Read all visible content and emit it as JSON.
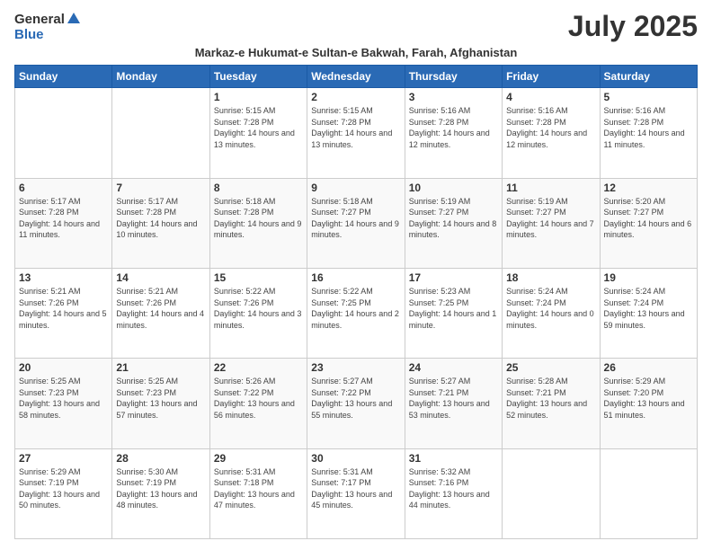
{
  "logo": {
    "general": "General",
    "blue": "Blue"
  },
  "title": "July 2025",
  "subtitle": "Markaz-e Hukumat-e Sultan-e Bakwah, Farah, Afghanistan",
  "days_header": [
    "Sunday",
    "Monday",
    "Tuesday",
    "Wednesday",
    "Thursday",
    "Friday",
    "Saturday"
  ],
  "weeks": [
    {
      "days": [
        {
          "num": "",
          "info": ""
        },
        {
          "num": "",
          "info": ""
        },
        {
          "num": "1",
          "info": "Sunrise: 5:15 AM\nSunset: 7:28 PM\nDaylight: 14 hours and 13 minutes."
        },
        {
          "num": "2",
          "info": "Sunrise: 5:15 AM\nSunset: 7:28 PM\nDaylight: 14 hours and 13 minutes."
        },
        {
          "num": "3",
          "info": "Sunrise: 5:16 AM\nSunset: 7:28 PM\nDaylight: 14 hours and 12 minutes."
        },
        {
          "num": "4",
          "info": "Sunrise: 5:16 AM\nSunset: 7:28 PM\nDaylight: 14 hours and 12 minutes."
        },
        {
          "num": "5",
          "info": "Sunrise: 5:16 AM\nSunset: 7:28 PM\nDaylight: 14 hours and 11 minutes."
        }
      ]
    },
    {
      "days": [
        {
          "num": "6",
          "info": "Sunrise: 5:17 AM\nSunset: 7:28 PM\nDaylight: 14 hours and 11 minutes."
        },
        {
          "num": "7",
          "info": "Sunrise: 5:17 AM\nSunset: 7:28 PM\nDaylight: 14 hours and 10 minutes."
        },
        {
          "num": "8",
          "info": "Sunrise: 5:18 AM\nSunset: 7:28 PM\nDaylight: 14 hours and 9 minutes."
        },
        {
          "num": "9",
          "info": "Sunrise: 5:18 AM\nSunset: 7:27 PM\nDaylight: 14 hours and 9 minutes."
        },
        {
          "num": "10",
          "info": "Sunrise: 5:19 AM\nSunset: 7:27 PM\nDaylight: 14 hours and 8 minutes."
        },
        {
          "num": "11",
          "info": "Sunrise: 5:19 AM\nSunset: 7:27 PM\nDaylight: 14 hours and 7 minutes."
        },
        {
          "num": "12",
          "info": "Sunrise: 5:20 AM\nSunset: 7:27 PM\nDaylight: 14 hours and 6 minutes."
        }
      ]
    },
    {
      "days": [
        {
          "num": "13",
          "info": "Sunrise: 5:21 AM\nSunset: 7:26 PM\nDaylight: 14 hours and 5 minutes."
        },
        {
          "num": "14",
          "info": "Sunrise: 5:21 AM\nSunset: 7:26 PM\nDaylight: 14 hours and 4 minutes."
        },
        {
          "num": "15",
          "info": "Sunrise: 5:22 AM\nSunset: 7:26 PM\nDaylight: 14 hours and 3 minutes."
        },
        {
          "num": "16",
          "info": "Sunrise: 5:22 AM\nSunset: 7:25 PM\nDaylight: 14 hours and 2 minutes."
        },
        {
          "num": "17",
          "info": "Sunrise: 5:23 AM\nSunset: 7:25 PM\nDaylight: 14 hours and 1 minute."
        },
        {
          "num": "18",
          "info": "Sunrise: 5:24 AM\nSunset: 7:24 PM\nDaylight: 14 hours and 0 minutes."
        },
        {
          "num": "19",
          "info": "Sunrise: 5:24 AM\nSunset: 7:24 PM\nDaylight: 13 hours and 59 minutes."
        }
      ]
    },
    {
      "days": [
        {
          "num": "20",
          "info": "Sunrise: 5:25 AM\nSunset: 7:23 PM\nDaylight: 13 hours and 58 minutes."
        },
        {
          "num": "21",
          "info": "Sunrise: 5:25 AM\nSunset: 7:23 PM\nDaylight: 13 hours and 57 minutes."
        },
        {
          "num": "22",
          "info": "Sunrise: 5:26 AM\nSunset: 7:22 PM\nDaylight: 13 hours and 56 minutes."
        },
        {
          "num": "23",
          "info": "Sunrise: 5:27 AM\nSunset: 7:22 PM\nDaylight: 13 hours and 55 minutes."
        },
        {
          "num": "24",
          "info": "Sunrise: 5:27 AM\nSunset: 7:21 PM\nDaylight: 13 hours and 53 minutes."
        },
        {
          "num": "25",
          "info": "Sunrise: 5:28 AM\nSunset: 7:21 PM\nDaylight: 13 hours and 52 minutes."
        },
        {
          "num": "26",
          "info": "Sunrise: 5:29 AM\nSunset: 7:20 PM\nDaylight: 13 hours and 51 minutes."
        }
      ]
    },
    {
      "days": [
        {
          "num": "27",
          "info": "Sunrise: 5:29 AM\nSunset: 7:19 PM\nDaylight: 13 hours and 50 minutes."
        },
        {
          "num": "28",
          "info": "Sunrise: 5:30 AM\nSunset: 7:19 PM\nDaylight: 13 hours and 48 minutes."
        },
        {
          "num": "29",
          "info": "Sunrise: 5:31 AM\nSunset: 7:18 PM\nDaylight: 13 hours and 47 minutes."
        },
        {
          "num": "30",
          "info": "Sunrise: 5:31 AM\nSunset: 7:17 PM\nDaylight: 13 hours and 45 minutes."
        },
        {
          "num": "31",
          "info": "Sunrise: 5:32 AM\nSunset: 7:16 PM\nDaylight: 13 hours and 44 minutes."
        },
        {
          "num": "",
          "info": ""
        },
        {
          "num": "",
          "info": ""
        }
      ]
    }
  ]
}
